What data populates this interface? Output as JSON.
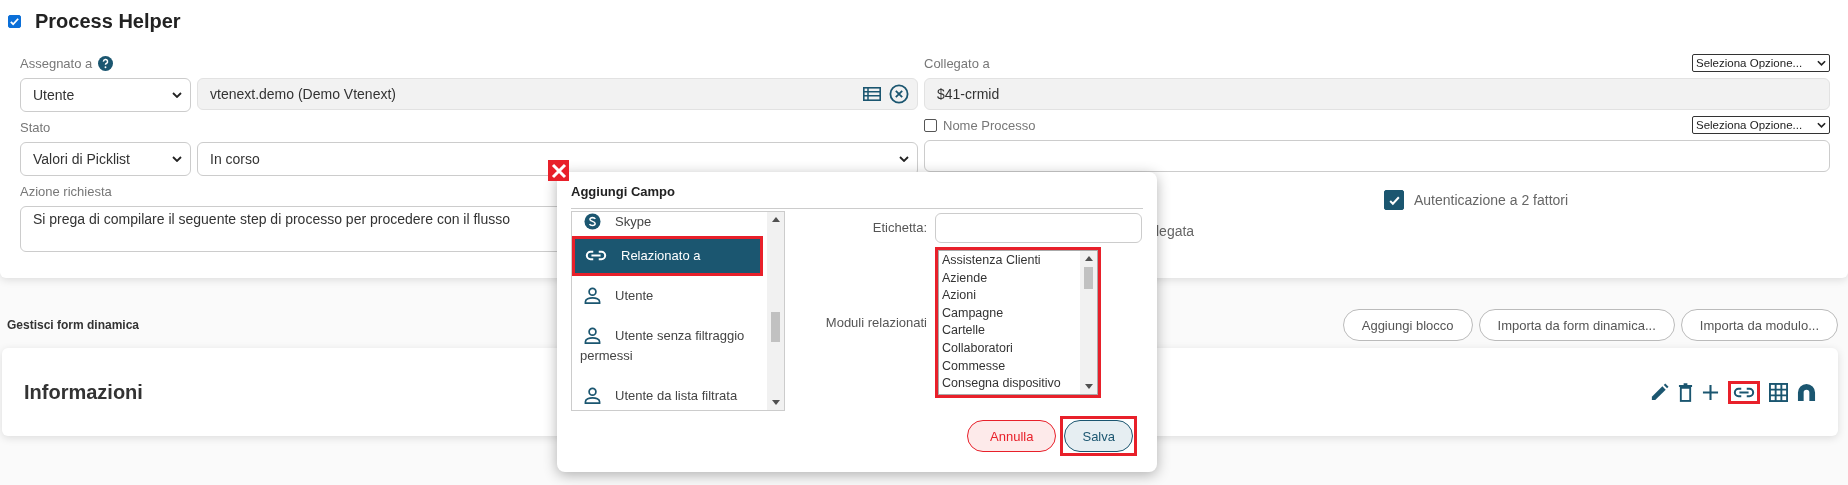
{
  "header": {
    "title": "Process Helper",
    "checked": true
  },
  "assigned": {
    "label": "Assegnato a",
    "type": "Utente",
    "value": "vtenext.demo (Demo Vtenext)"
  },
  "status": {
    "label": "Stato",
    "type": "Valori di Picklist",
    "value": "In corso"
  },
  "action": {
    "label": "Azione richiesta",
    "value": "Si prega di compilare il seguente step di processo per procedere con il flusso"
  },
  "linked": {
    "label": "Collegato a",
    "option": "Seleziona Opzione...",
    "value": "$41-crmid"
  },
  "process_name": {
    "label": "Nome Processo",
    "checked": false,
    "option": "Seleziona Opzione..."
  },
  "two_factor": {
    "label": "Autenticazione a 2 fattori",
    "checked": true
  },
  "covered_label": "legata",
  "dynamic_form": {
    "title": "Gestisci form dinamica",
    "buttons": [
      "Aggiungi blocco",
      "Importa da form dinamica...",
      "Importa da modulo..."
    ]
  },
  "block": {
    "title": "Informazioni",
    "tools": [
      {
        "kind": "edit",
        "highlighted": false
      },
      {
        "kind": "delete",
        "highlighted": false
      },
      {
        "kind": "add",
        "highlighted": false
      },
      {
        "kind": "link",
        "highlighted": true
      },
      {
        "kind": "table",
        "highlighted": false
      },
      {
        "kind": "magnet",
        "highlighted": false
      }
    ]
  },
  "dialog": {
    "title": "Aggiungi Campo",
    "field_types": [
      {
        "label": "Skype",
        "kind": "skype",
        "selected": false,
        "highlighted": false
      },
      {
        "label": "Relazionato a",
        "kind": "link",
        "selected": true,
        "highlighted": true
      },
      {
        "label": "Utente",
        "kind": "user",
        "selected": false,
        "highlighted": false
      },
      {
        "label": "Utente senza filtraggio permessi",
        "kind": "user",
        "selected": false,
        "highlighted": false
      },
      {
        "label": "Utente da lista filtrata",
        "kind": "user",
        "selected": false,
        "highlighted": false
      }
    ],
    "label_field": {
      "label": "Etichetta:"
    },
    "modules": {
      "label": "Moduli relazionati",
      "highlighted": true,
      "options": [
        "Assistenza Clienti",
        "Aziende",
        "Azioni",
        "Campagne",
        "Cartelle",
        "Collaboratori",
        "Commesse",
        "Consegna dispositivo"
      ]
    },
    "buttons": [
      {
        "label": "Annulla",
        "kind": "cancel",
        "highlighted": false
      },
      {
        "label": "Salva",
        "kind": "save",
        "highlighted": true
      }
    ]
  }
}
